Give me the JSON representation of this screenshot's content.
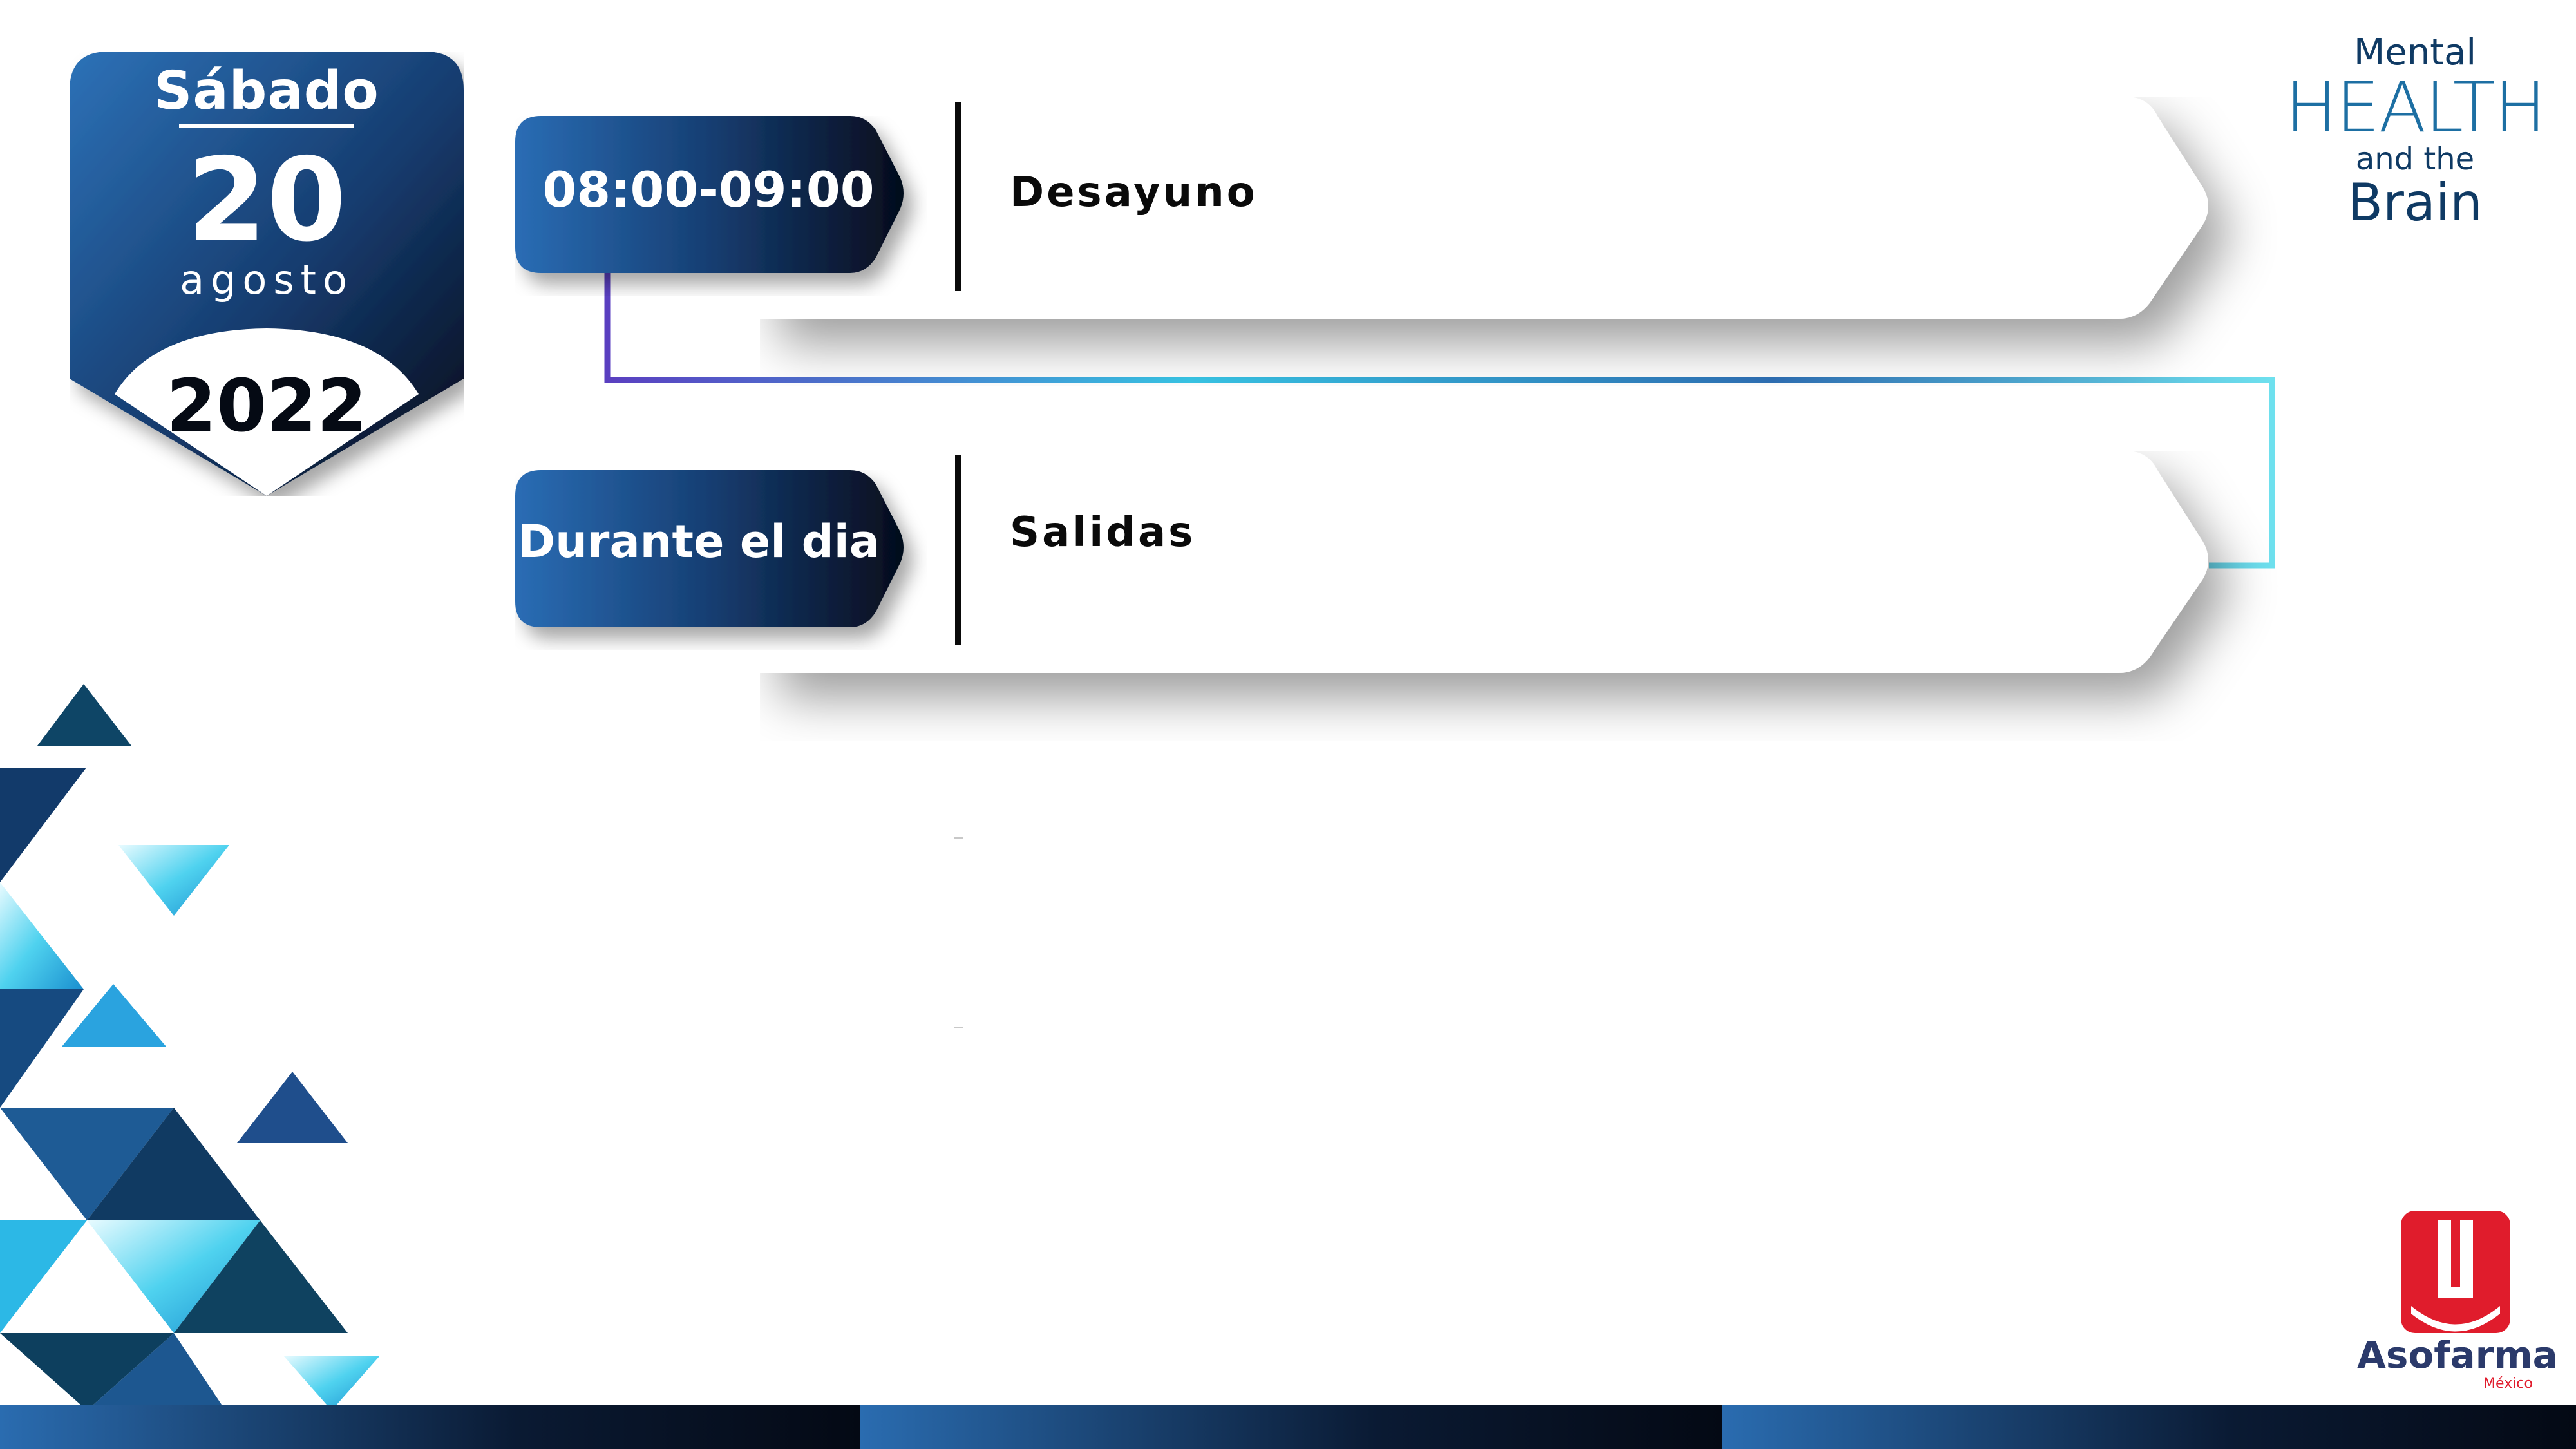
{
  "date_badge": {
    "weekday": "Sábado",
    "day": "20",
    "month": "agosto",
    "year": "2022"
  },
  "schedule": [
    {
      "time": "08:00-09:00",
      "event": "Desayuno"
    },
    {
      "time": "Durante el dia",
      "event": "Salidas"
    }
  ],
  "logos": {
    "mental_health": {
      "line1": "Mental",
      "line2": "HEALTH",
      "line3": "and the",
      "line4": "Brain"
    },
    "asofarma": {
      "name": "Asofarma",
      "country": "México"
    }
  },
  "colors": {
    "navy": "#0b1a33",
    "blue": "#2a6cb0",
    "cyan": "#35c8ea",
    "brand_red": "#e01c2c",
    "text_dark": "#0a0a0a"
  },
  "icons": {
    "connector": "timeline-connector-line",
    "decor": "triangle-pattern"
  }
}
